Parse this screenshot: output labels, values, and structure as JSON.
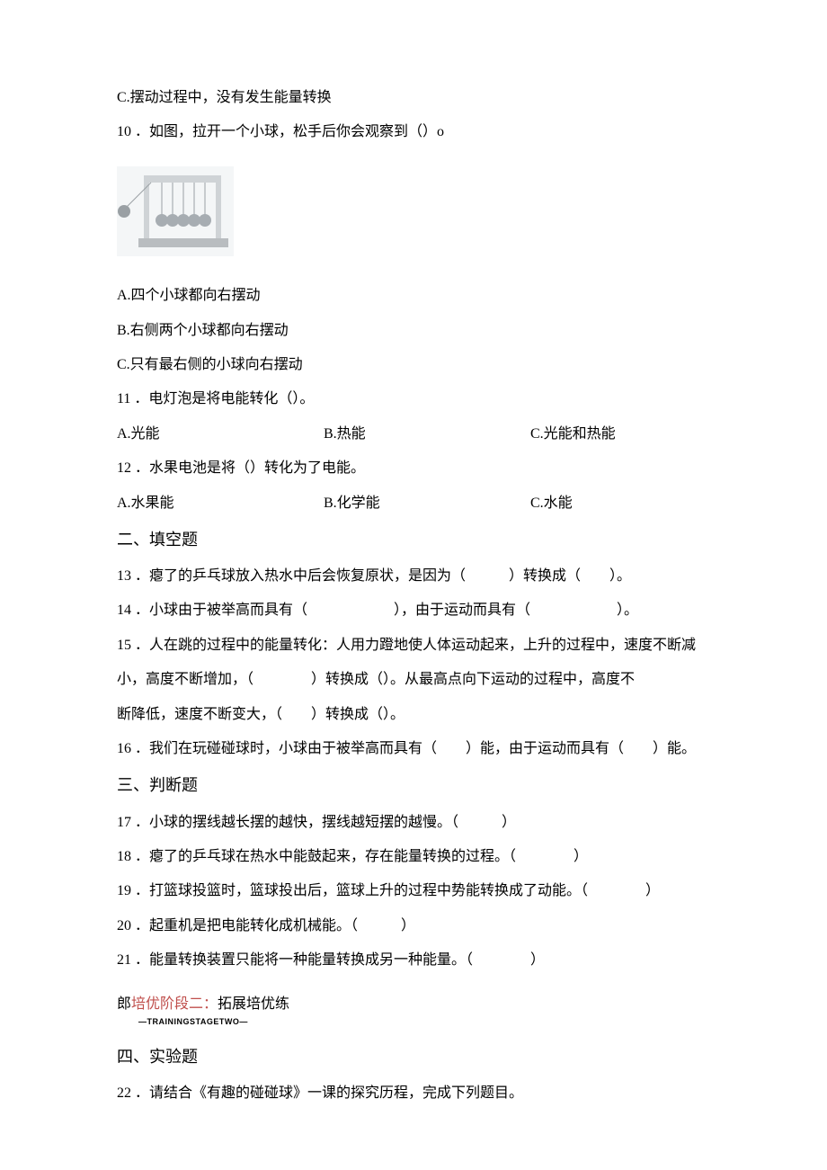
{
  "q9": {
    "optC": "C.摆动过程中，没有发生能量转换"
  },
  "q10": {
    "stem": "10 ．如图，拉开一个小球，松手后你会观察到（）o",
    "optA": "A.四个小球都向右摆动",
    "optB": "B.右侧两个小球都向右摆动",
    "optC": "C.只有最右侧的小球向右摆动"
  },
  "q11": {
    "stem": "11 ．电灯泡是将电能转化（）。",
    "optA": "A.光能",
    "optB": "B.热能",
    "optC": "C.光能和热能"
  },
  "q12": {
    "stem": "12 ．水果电池是将（）转化为了电能。",
    "optA": "A.水果能",
    "optB": "B.化学能",
    "optC": "C.水能"
  },
  "sections": {
    "fill": "二、填空题",
    "judge": "三、判断题",
    "experiment": "四、实验题"
  },
  "q13": "13 ．瘪了的乒乓球放入热水中后会恢复原状，是因为（　　　）转换成（　　）。",
  "q14": "14 ．小球由于被举高而具有（　　　　　　），由于运动而具有（　　　　　　）。",
  "q15a": "15 ．人在跳的过程中的能量转化：人用力蹬地使人体运动起来，上升的过程中，速度不断减",
  "q15b": "小，高度不断增加，（　　　　）转换成（）。从最高点向下运动的过程中，高度不",
  "q15c": "断降低，速度不断变大，（　　）转换成（）。",
  "q16": "16 ．我们在玩碰碰球时，小球由于被举高而具有（　　）能，由于运动而具有（　　）能。",
  "q17": "17 ．小球的摆线越长摆的越快，摆线越短摆的越慢。（　　　）",
  "q18": "18 ．瘪了的乒乓球在热水中能鼓起来，存在能量转换的过程。（　　　　）",
  "q19": "19 ．打篮球投篮时，篮球投出后，篮球上升的过程中势能转换成了动能。（　　　　）",
  "q20": "20 ．起重机是把电能转化成机械能。（　　　）",
  "q21": "21 ．能量转换装置只能将一种能量转换成另一种能量。（　　　　）",
  "stage": {
    "prefix": "郎",
    "label": "培优阶段二：",
    "suffix": "拓展培优练",
    "sub": "—TRAININGSTAGETWO—"
  },
  "q22": "22 ．请结合《有趣的碰碰球》一课的探究历程，完成下列题目。"
}
